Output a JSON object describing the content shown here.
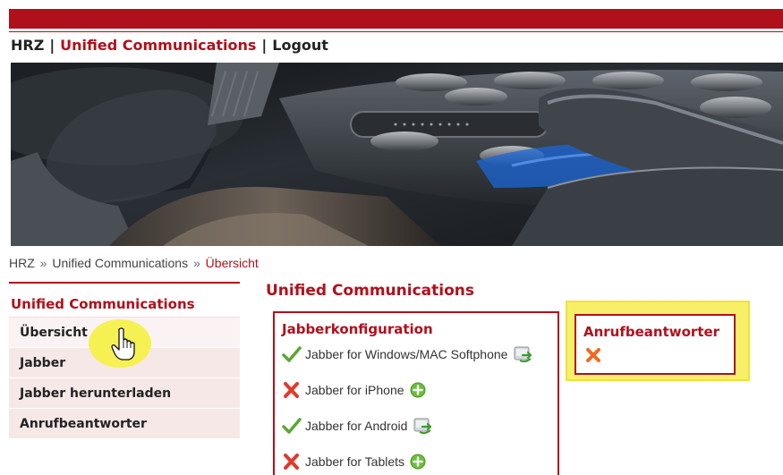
{
  "topnav": {
    "home": "HRZ",
    "separator": "|",
    "section": "Unified Communications",
    "logout": "Logout"
  },
  "breadcrumb": {
    "items": [
      "HRZ",
      "Unified Communications",
      "Übersicht"
    ],
    "separator": "»"
  },
  "sidebar": {
    "title": "Unified Communications",
    "items": [
      {
        "label": "Übersicht"
      },
      {
        "label": "Jabber"
      },
      {
        "label": "Jabber herunterladen"
      },
      {
        "label": "Anrufbeantworter"
      }
    ]
  },
  "main": {
    "title": "Unified Communications",
    "jabber": {
      "title": "Jabberkonfiguration",
      "rows": [
        {
          "label": "Jabber for Windows/MAC Softphone",
          "status": "check-icon",
          "action": "configure-icon"
        },
        {
          "label": "Jabber for iPhone",
          "status": "cross-icon",
          "action": "add-icon"
        },
        {
          "label": "Jabber for Android",
          "status": "check-icon",
          "action": "configure-icon"
        },
        {
          "label": "Jabber for Tablets",
          "status": "cross-icon",
          "action": "add-icon"
        }
      ]
    },
    "voicemail": {
      "title": "Anrufbeantworter",
      "status": "cross-icon"
    }
  },
  "colors": {
    "accent": "#b0101c",
    "highlight": "#f7ef67",
    "check": "#5aa832",
    "cross": "#e03a2c",
    "add": "#6cbf3a"
  }
}
